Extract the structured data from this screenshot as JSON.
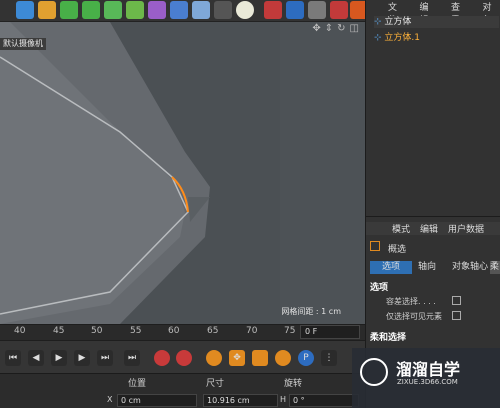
{
  "viewport": {
    "camera_label": "默认摄像机",
    "grid_spacing": "网格间距 : 1 cm"
  },
  "timeline": {
    "ticks": [
      "40",
      "45",
      "50",
      "55",
      "60",
      "65",
      "70",
      "75"
    ],
    "current_frame": "0 F"
  },
  "coordinates": {
    "headers": {
      "position": "位置",
      "size": "尺寸",
      "rotation": "旋转"
    },
    "x_label": "X",
    "x_position": "0 cm",
    "x_size": "10.916 cm",
    "h_label": "H",
    "h_rotation": "0 °"
  },
  "object_manager": {
    "menu": [
      "文件",
      "编辑",
      "查看",
      "对象"
    ],
    "objects": [
      {
        "name": "立方体"
      },
      {
        "name": "立方体.1"
      }
    ]
  },
  "attributes": {
    "menu": [
      "模式",
      "编辑",
      "用户数据"
    ],
    "mode": "概选",
    "tabs": [
      "选项",
      "轴向",
      "对象轴心",
      "柔"
    ],
    "section_options": "选项",
    "opt1": "容差选择. . . .",
    "opt2": "仅选择可见元素",
    "section_soft": "柔和选择"
  },
  "watermark": {
    "title": "溜溜自学",
    "url": "ZIXUE.3D66.COM"
  },
  "colors": {
    "accent": "#ff8c1a",
    "tab_active": "#2e6fb3"
  }
}
